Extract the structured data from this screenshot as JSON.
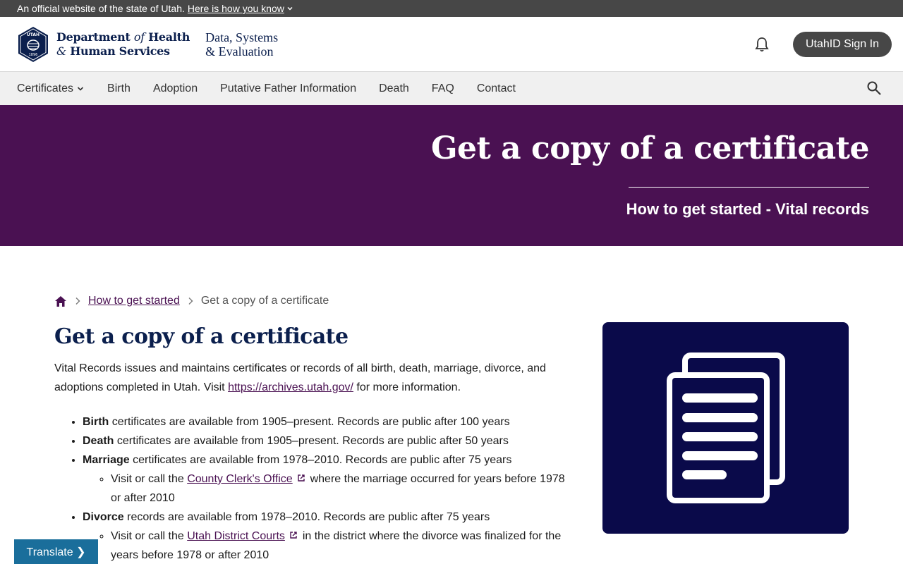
{
  "gov_banner": {
    "text": "An official website of the state of Utah.",
    "link": "Here is how you know"
  },
  "header": {
    "seal_top": "UTAH",
    "seal_year": "1896",
    "dept_line1_a": "Department",
    "dept_line1_b": "of",
    "dept_line1_c": "Health",
    "dept_line2_a": "&",
    "dept_line2_b": "Human Services",
    "division_line1": "Data, Systems",
    "division_line2": "& Evaluation",
    "signin": "UtahID Sign In",
    "icons": [
      "bell-icon"
    ]
  },
  "nav": {
    "items": [
      "Certificates",
      "Birth",
      "Adoption",
      "Putative Father Information",
      "Death",
      "FAQ",
      "Contact"
    ],
    "icons": [
      "chevron-down-icon",
      "search-icon"
    ]
  },
  "hero": {
    "title": "Get a copy of a certificate",
    "subtitle": "How to get started - Vital records"
  },
  "breadcrumb": {
    "home_icon": "home-icon",
    "link": "How to get started",
    "current": "Get a copy of a certificate"
  },
  "main": {
    "title": "Get a copy of a certificate",
    "intro_a": "Vital Records issues and maintains certificates or records of all birth, death, marriage, divorce, and adoptions completed in Utah. Visit",
    "intro_link": "https://archives.utah.gov/",
    "intro_b": "for more information.",
    "items": [
      {
        "bold": "Birth",
        "text": "certificates are available from 1905–present. Records are public after 100 years"
      },
      {
        "bold": "Death",
        "text": "certificates are available from 1905–present. Records are public after 50 years"
      },
      {
        "bold": "Marriage",
        "text": "certificates are available from 1978–2010. Records are public after 75 years",
        "sub_a": "Visit or call the",
        "sub_link": "County Clerk's Office",
        "sub_b": "where the marriage occurred for years before 1978 or after 2010"
      },
      {
        "bold": "Divorce",
        "text": "records are available from 1978–2010. Records are public after 75 years",
        "sub_a": "Visit or call the",
        "sub_link": "Utah District Courts",
        "sub_b": "in the district where the divorce was finalized for the years before 1978 or after 2010"
      }
    ]
  },
  "side_card": {
    "icon": "documents-icon"
  },
  "translate": "Translate ❯"
}
